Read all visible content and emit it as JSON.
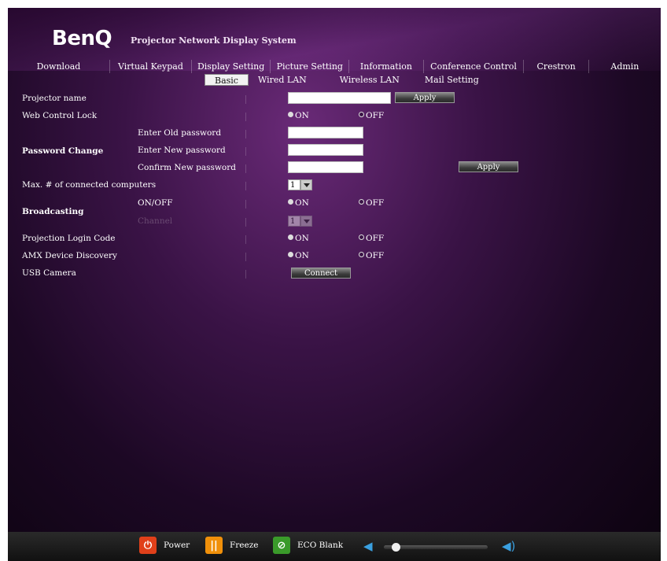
{
  "header": {
    "logo": "BenQ",
    "title": "Projector Network Display System"
  },
  "nav": {
    "tabs": [
      "Download",
      "Virtual Keypad",
      "Display Setting",
      "Picture Setting",
      "Information",
      "Conference Control",
      "Crestron",
      "Admin"
    ]
  },
  "subnav": {
    "tabs": [
      "Basic",
      "Wired LAN",
      "Wireless LAN",
      "Mail Setting"
    ],
    "active": "Basic"
  },
  "form": {
    "projector_name": {
      "label": "Projector name",
      "value": "",
      "button": "Apply"
    },
    "web_control_lock": {
      "label": "Web Control Lock",
      "on": "ON",
      "off": "OFF",
      "selected": "OFF"
    },
    "password_change": {
      "label": "Password Change",
      "old_label": "Enter Old password",
      "new_label": "Enter New password",
      "confirm_label": "Confirm New password",
      "button": "Apply"
    },
    "max_computers": {
      "label": "Max. # of connected computers",
      "value": "1"
    },
    "broadcasting": {
      "label": "Broadcasting",
      "onoff_label": "ON/OFF",
      "on": "ON",
      "off": "OFF",
      "selected": "OFF",
      "channel_label": "Channel",
      "channel_value": "1"
    },
    "projection_login_code": {
      "label": "Projection Login Code",
      "on": "ON",
      "off": "OFF",
      "selected": "OFF"
    },
    "amx_discovery": {
      "label": "AMX Device Discovery",
      "on": "ON",
      "off": "OFF",
      "selected": "OFF"
    },
    "usb_camera": {
      "label": "USB Camera",
      "button": "Connect"
    }
  },
  "footer": {
    "power": "Power",
    "freeze": "Freeze",
    "eco_blank": "ECO Blank",
    "volume": 0.08,
    "colors": {
      "power": "#e0401a",
      "freeze": "#f0900a",
      "eco": "#3a9a2a",
      "volume_icon": "#3aa0e0"
    }
  }
}
